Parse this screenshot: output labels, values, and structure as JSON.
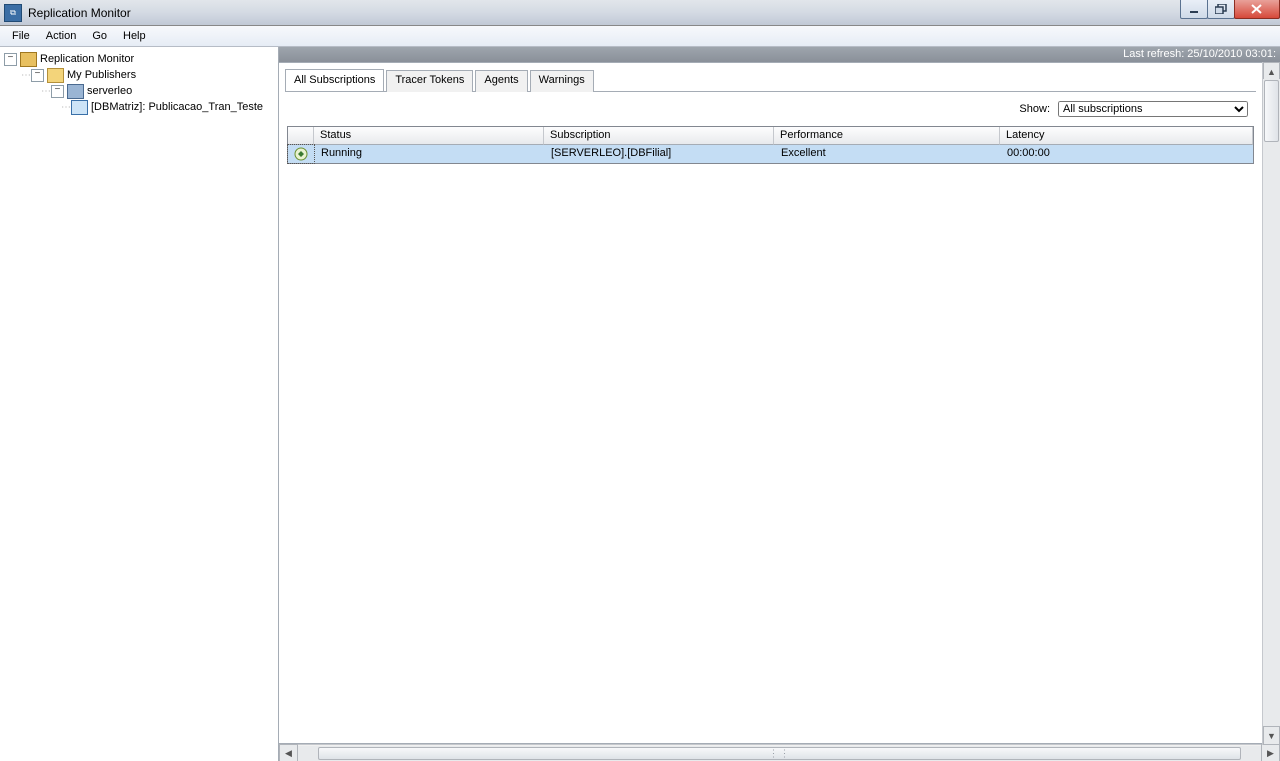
{
  "window": {
    "title": "Replication Monitor"
  },
  "menu": {
    "file": "File",
    "action": "Action",
    "go": "Go",
    "help": "Help"
  },
  "tree": {
    "root": "Replication Monitor",
    "publishers": "My Publishers",
    "server": "serverleo",
    "publication": "[DBMatriz]: Publicacao_Tran_Teste"
  },
  "refresh": "Last refresh: 25/10/2010 03:01:",
  "tabs": {
    "all": "All Subscriptions",
    "tracer": "Tracer Tokens",
    "agents": "Agents",
    "warnings": "Warnings"
  },
  "filter": {
    "label": "Show:",
    "value": "All subscriptions"
  },
  "grid": {
    "headers": {
      "status": "Status",
      "subscription": "Subscription",
      "performance": "Performance",
      "latency": "Latency"
    },
    "rows": [
      {
        "status": "Running",
        "subscription": "[SERVERLEO].[DBFilial]",
        "performance": "Excellent",
        "latency": "00:00:00"
      }
    ]
  }
}
